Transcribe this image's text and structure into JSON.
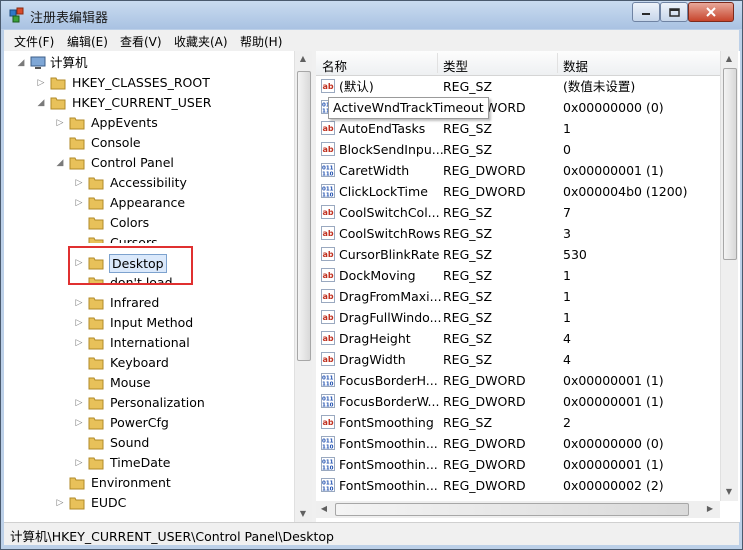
{
  "window": {
    "title": "注册表编辑器"
  },
  "menu": [
    "文件(F)",
    "编辑(E)",
    "查看(V)",
    "收藏夹(A)",
    "帮助(H)"
  ],
  "tree": {
    "root": "计算机",
    "hkcr": "HKEY_CLASSES_ROOT",
    "hkcu": "HKEY_CURRENT_USER",
    "hkcu_children": [
      "AppEvents",
      "Console",
      "Control Panel"
    ],
    "control_panel_children": [
      "Accessibility",
      "Appearance",
      "Colors",
      "Cursors",
      "Desktop",
      "don't load",
      "Infrared",
      "Input Method",
      "International",
      "Keyboard",
      "Mouse",
      "Personalization",
      "PowerCfg",
      "Sound",
      "TimeDate"
    ],
    "after_cp": [
      "Environment",
      "EUDC"
    ],
    "selected": "Desktop"
  },
  "list": {
    "headers": {
      "name": "名称",
      "type": "类型",
      "data": "数据"
    },
    "tooltip": "ActiveWndTrackTimeout",
    "rows": [
      {
        "icon": "ab",
        "name": "(默认)",
        "type": "REG_SZ",
        "data": "(数值未设置)"
      },
      {
        "icon": "bin",
        "name": "ActiveWndTrac...",
        "type": "REG_DWORD",
        "data": "0x00000000 (0)"
      },
      {
        "icon": "ab",
        "name": "AutoEndTasks",
        "type": "REG_SZ",
        "data": "1"
      },
      {
        "icon": "ab",
        "name": "BlockSendInpu...",
        "type": "REG_SZ",
        "data": "0"
      },
      {
        "icon": "bin",
        "name": "CaretWidth",
        "type": "REG_DWORD",
        "data": "0x00000001 (1)"
      },
      {
        "icon": "bin",
        "name": "ClickLockTime",
        "type": "REG_DWORD",
        "data": "0x000004b0 (1200)"
      },
      {
        "icon": "ab",
        "name": "CoolSwitchCol...",
        "type": "REG_SZ",
        "data": "7"
      },
      {
        "icon": "ab",
        "name": "CoolSwitchRows",
        "type": "REG_SZ",
        "data": "3"
      },
      {
        "icon": "ab",
        "name": "CursorBlinkRate",
        "type": "REG_SZ",
        "data": "530"
      },
      {
        "icon": "ab",
        "name": "DockMoving",
        "type": "REG_SZ",
        "data": "1"
      },
      {
        "icon": "ab",
        "name": "DragFromMaxi...",
        "type": "REG_SZ",
        "data": "1"
      },
      {
        "icon": "ab",
        "name": "DragFullWindo...",
        "type": "REG_SZ",
        "data": "1"
      },
      {
        "icon": "ab",
        "name": "DragHeight",
        "type": "REG_SZ",
        "data": "4"
      },
      {
        "icon": "ab",
        "name": "DragWidth",
        "type": "REG_SZ",
        "data": "4"
      },
      {
        "icon": "bin",
        "name": "FocusBorderH...",
        "type": "REG_DWORD",
        "data": "0x00000001 (1)"
      },
      {
        "icon": "bin",
        "name": "FocusBorderW...",
        "type": "REG_DWORD",
        "data": "0x00000001 (1)"
      },
      {
        "icon": "ab",
        "name": "FontSmoothing",
        "type": "REG_SZ",
        "data": "2"
      },
      {
        "icon": "bin",
        "name": "FontSmoothin...",
        "type": "REG_DWORD",
        "data": "0x00000000 (0)"
      },
      {
        "icon": "bin",
        "name": "FontSmoothin...",
        "type": "REG_DWORD",
        "data": "0x00000001 (1)"
      },
      {
        "icon": "bin",
        "name": "FontSmoothin...",
        "type": "REG_DWORD",
        "data": "0x00000002 (2)"
      }
    ]
  },
  "status": {
    "path": "计算机\\HKEY_CURRENT_USER\\Control Panel\\Desktop"
  },
  "colors": {
    "highlight_box": "#e03030",
    "selection": "#dbe9fb",
    "folder": "#e8c15a"
  }
}
